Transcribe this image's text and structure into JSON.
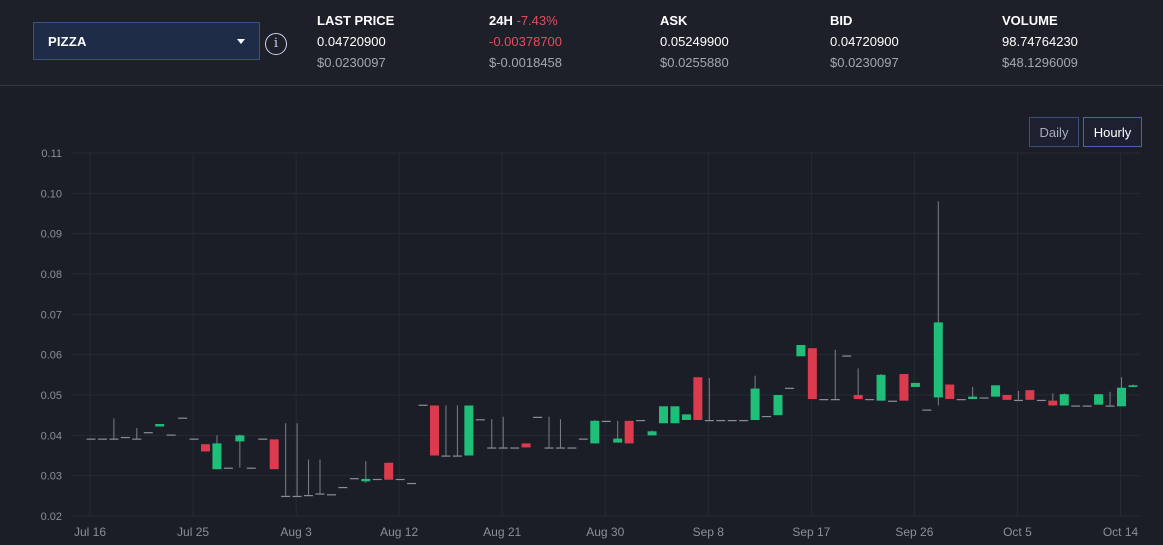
{
  "pair_selector": {
    "label": "PIZZA"
  },
  "stats": {
    "last_price": {
      "title": "LAST PRICE",
      "value": "0.04720900",
      "usd": "$0.0230097"
    },
    "change_24h": {
      "title": "24H",
      "percent": "-7.43%",
      "value": "-0.00378700",
      "usd": "$-0.0018458"
    },
    "ask": {
      "title": "ASK",
      "value": "0.05249900",
      "usd": "$0.0255880"
    },
    "bid": {
      "title": "BID",
      "value": "0.04720900",
      "usd": "$0.0230097"
    },
    "volume": {
      "title": "VOLUME",
      "value": "98.74764230",
      "usd": "$48.1296009"
    }
  },
  "timeframe": {
    "daily_label": "Daily",
    "hourly_label": "Hourly",
    "selected": "Hourly"
  },
  "colors": {
    "up": "#1fbf79",
    "down": "#dc3b4e",
    "wick": "#7b7f8a",
    "grid": "#262a34",
    "axis_text": "#8b8f99",
    "accent": "#34518a"
  },
  "chart_data": {
    "type": "candlestick",
    "x_tick_labels": [
      "Jul 16",
      "Jul 25",
      "Aug 3",
      "Aug 12",
      "Aug 21",
      "Aug 30",
      "Sep 8",
      "Sep 17",
      "Sep 26",
      "Oct 5",
      "Oct 14"
    ],
    "y_tick_labels": [
      "0.11",
      "0.10",
      "0.09",
      "0.08",
      "0.07",
      "0.06",
      "0.05",
      "0.04",
      "0.03",
      "0.02"
    ],
    "ylim": [
      0.02,
      0.11
    ],
    "x_start": "Jul 16",
    "grid": true,
    "candles": [
      {
        "date": "Jul 16",
        "o": 0.0392,
        "h": 0.0392,
        "l": 0.0392,
        "c": 0.0392
      },
      {
        "date": "Jul 17",
        "o": 0.0392,
        "h": 0.0392,
        "l": 0.0392,
        "c": 0.0392
      },
      {
        "date": "Jul 18",
        "o": 0.0392,
        "h": 0.0442,
        "l": 0.0392,
        "c": 0.0392
      },
      {
        "date": "Jul 19",
        "o": 0.0396,
        "h": 0.0396,
        "l": 0.0396,
        "c": 0.0396
      },
      {
        "date": "Jul 20",
        "o": 0.0392,
        "h": 0.0418,
        "l": 0.0392,
        "c": 0.0392
      },
      {
        "date": "Jul 21",
        "o": 0.0408,
        "h": 0.0408,
        "l": 0.0408,
        "c": 0.0408
      },
      {
        "date": "Jul 22",
        "o": 0.0422,
        "h": 0.0428,
        "l": 0.0422,
        "c": 0.0428
      },
      {
        "date": "Jul 23",
        "o": 0.0402,
        "h": 0.0402,
        "l": 0.0402,
        "c": 0.0402
      },
      {
        "date": "Jul 24",
        "o": 0.0444,
        "h": 0.0444,
        "l": 0.0444,
        "c": 0.0444
      },
      {
        "date": "Jul 25",
        "o": 0.0392,
        "h": 0.0392,
        "l": 0.0392,
        "c": 0.0392
      },
      {
        "date": "Jul 26",
        "o": 0.0378,
        "h": 0.0378,
        "l": 0.036,
        "c": 0.036
      },
      {
        "date": "Jul 27",
        "o": 0.0316,
        "h": 0.04,
        "l": 0.0316,
        "c": 0.038
      },
      {
        "date": "Jul 28",
        "o": 0.032,
        "h": 0.032,
        "l": 0.032,
        "c": 0.032
      },
      {
        "date": "Jul 29",
        "o": 0.0385,
        "h": 0.0402,
        "l": 0.032,
        "c": 0.04
      },
      {
        "date": "Jul 30",
        "o": 0.032,
        "h": 0.032,
        "l": 0.032,
        "c": 0.032
      },
      {
        "date": "Jul 31",
        "o": 0.0392,
        "h": 0.0392,
        "l": 0.0392,
        "c": 0.0392
      },
      {
        "date": "Aug 1",
        "o": 0.039,
        "h": 0.039,
        "l": 0.0316,
        "c": 0.0316
      },
      {
        "date": "Aug 2",
        "o": 0.025,
        "h": 0.043,
        "l": 0.025,
        "c": 0.025
      },
      {
        "date": "Aug 3",
        "o": 0.025,
        "h": 0.043,
        "l": 0.025,
        "c": 0.025
      },
      {
        "date": "Aug 4",
        "o": 0.0252,
        "h": 0.034,
        "l": 0.0252,
        "c": 0.0252
      },
      {
        "date": "Aug 5",
        "o": 0.0256,
        "h": 0.034,
        "l": 0.0256,
        "c": 0.0256
      },
      {
        "date": "Aug 6",
        "o": 0.0254,
        "h": 0.0254,
        "l": 0.0254,
        "c": 0.0254
      },
      {
        "date": "Aug 7",
        "o": 0.0272,
        "h": 0.0272,
        "l": 0.0272,
        "c": 0.0272
      },
      {
        "date": "Aug 8",
        "o": 0.0294,
        "h": 0.0294,
        "l": 0.0294,
        "c": 0.0294
      },
      {
        "date": "Aug 9",
        "o": 0.0286,
        "h": 0.0336,
        "l": 0.0282,
        "c": 0.0292
      },
      {
        "date": "Aug 10",
        "o": 0.0292,
        "h": 0.0292,
        "l": 0.0292,
        "c": 0.0292
      },
      {
        "date": "Aug 11",
        "o": 0.0332,
        "h": 0.0332,
        "l": 0.029,
        "c": 0.029
      },
      {
        "date": "Aug 12",
        "o": 0.0292,
        "h": 0.0292,
        "l": 0.0292,
        "c": 0.0292
      },
      {
        "date": "Aug 13",
        "o": 0.0282,
        "h": 0.0282,
        "l": 0.0282,
        "c": 0.0282
      },
      {
        "date": "Aug 14",
        "o": 0.0476,
        "h": 0.0476,
        "l": 0.0476,
        "c": 0.0476
      },
      {
        "date": "Aug 15",
        "o": 0.0474,
        "h": 0.0474,
        "l": 0.035,
        "c": 0.035
      },
      {
        "date": "Aug 16",
        "o": 0.035,
        "h": 0.0474,
        "l": 0.035,
        "c": 0.035
      },
      {
        "date": "Aug 17",
        "o": 0.035,
        "h": 0.0474,
        "l": 0.035,
        "c": 0.035
      },
      {
        "date": "Aug 18",
        "o": 0.035,
        "h": 0.0474,
        "l": 0.035,
        "c": 0.0474
      },
      {
        "date": "Aug 19",
        "o": 0.044,
        "h": 0.044,
        "l": 0.044,
        "c": 0.044
      },
      {
        "date": "Aug 20",
        "o": 0.037,
        "h": 0.044,
        "l": 0.037,
        "c": 0.037
      },
      {
        "date": "Aug 21",
        "o": 0.037,
        "h": 0.0446,
        "l": 0.037,
        "c": 0.037
      },
      {
        "date": "Aug 22",
        "o": 0.037,
        "h": 0.037,
        "l": 0.037,
        "c": 0.037
      },
      {
        "date": "Aug 23",
        "o": 0.038,
        "h": 0.038,
        "l": 0.037,
        "c": 0.037
      },
      {
        "date": "Aug 24",
        "o": 0.0446,
        "h": 0.0446,
        "l": 0.0446,
        "c": 0.0446
      },
      {
        "date": "Aug 25",
        "o": 0.037,
        "h": 0.0446,
        "l": 0.037,
        "c": 0.037
      },
      {
        "date": "Aug 26",
        "o": 0.037,
        "h": 0.044,
        "l": 0.037,
        "c": 0.037
      },
      {
        "date": "Aug 27",
        "o": 0.037,
        "h": 0.037,
        "l": 0.037,
        "c": 0.037
      },
      {
        "date": "Aug 28",
        "o": 0.0392,
        "h": 0.0392,
        "l": 0.0392,
        "c": 0.0392
      },
      {
        "date": "Aug 29",
        "o": 0.038,
        "h": 0.0438,
        "l": 0.038,
        "c": 0.0436
      },
      {
        "date": "Aug 30",
        "o": 0.0436,
        "h": 0.0436,
        "l": 0.0436,
        "c": 0.0436
      },
      {
        "date": "Aug 31",
        "o": 0.0382,
        "h": 0.0436,
        "l": 0.0382,
        "c": 0.0392
      },
      {
        "date": "Sep 1",
        "o": 0.0436,
        "h": 0.0436,
        "l": 0.038,
        "c": 0.038
      },
      {
        "date": "Sep 2",
        "o": 0.0438,
        "h": 0.0438,
        "l": 0.0438,
        "c": 0.0438
      },
      {
        "date": "Sep 3",
        "o": 0.04,
        "h": 0.0412,
        "l": 0.04,
        "c": 0.041
      },
      {
        "date": "Sep 4",
        "o": 0.043,
        "h": 0.0472,
        "l": 0.043,
        "c": 0.0472
      },
      {
        "date": "Sep 5",
        "o": 0.043,
        "h": 0.0472,
        "l": 0.043,
        "c": 0.0472
      },
      {
        "date": "Sep 6",
        "o": 0.0438,
        "h": 0.0452,
        "l": 0.0438,
        "c": 0.0452
      },
      {
        "date": "Sep 7",
        "o": 0.0544,
        "h": 0.0544,
        "l": 0.0438,
        "c": 0.0438
      },
      {
        "date": "Sep 8",
        "o": 0.0438,
        "h": 0.0542,
        "l": 0.0438,
        "c": 0.0438
      },
      {
        "date": "Sep 9",
        "o": 0.0438,
        "h": 0.0438,
        "l": 0.0438,
        "c": 0.0438
      },
      {
        "date": "Sep 10",
        "o": 0.0438,
        "h": 0.0438,
        "l": 0.0438,
        "c": 0.0438
      },
      {
        "date": "Sep 11",
        "o": 0.0438,
        "h": 0.0438,
        "l": 0.0438,
        "c": 0.0438
      },
      {
        "date": "Sep 12",
        "o": 0.0438,
        "h": 0.0548,
        "l": 0.0438,
        "c": 0.0516
      },
      {
        "date": "Sep 13",
        "o": 0.0448,
        "h": 0.0448,
        "l": 0.0448,
        "c": 0.0448
      },
      {
        "date": "Sep 14",
        "o": 0.045,
        "h": 0.05,
        "l": 0.045,
        "c": 0.05
      },
      {
        "date": "Sep 15",
        "o": 0.0518,
        "h": 0.0518,
        "l": 0.0518,
        "c": 0.0518
      },
      {
        "date": "Sep 16",
        "o": 0.0596,
        "h": 0.0624,
        "l": 0.0596,
        "c": 0.0624
      },
      {
        "date": "Sep 17",
        "o": 0.0616,
        "h": 0.0616,
        "l": 0.049,
        "c": 0.049
      },
      {
        "date": "Sep 18",
        "o": 0.049,
        "h": 0.049,
        "l": 0.049,
        "c": 0.049
      },
      {
        "date": "Sep 19",
        "o": 0.049,
        "h": 0.0612,
        "l": 0.049,
        "c": 0.049
      },
      {
        "date": "Sep 20",
        "o": 0.0598,
        "h": 0.0598,
        "l": 0.0598,
        "c": 0.0598
      },
      {
        "date": "Sep 21",
        "o": 0.05,
        "h": 0.0566,
        "l": 0.049,
        "c": 0.049
      },
      {
        "date": "Sep 22",
        "o": 0.049,
        "h": 0.049,
        "l": 0.049,
        "c": 0.049
      },
      {
        "date": "Sep 23",
        "o": 0.0486,
        "h": 0.0552,
        "l": 0.0486,
        "c": 0.055
      },
      {
        "date": "Sep 24",
        "o": 0.0486,
        "h": 0.0486,
        "l": 0.0486,
        "c": 0.0486
      },
      {
        "date": "Sep 25",
        "o": 0.0552,
        "h": 0.0552,
        "l": 0.0486,
        "c": 0.0486
      },
      {
        "date": "Sep 26",
        "o": 0.052,
        "h": 0.053,
        "l": 0.052,
        "c": 0.053
      },
      {
        "date": "Sep 27",
        "o": 0.0464,
        "h": 0.0464,
        "l": 0.0464,
        "c": 0.0464
      },
      {
        "date": "Sep 28",
        "o": 0.0494,
        "h": 0.098,
        "l": 0.0474,
        "c": 0.068
      },
      {
        "date": "Sep 29",
        "o": 0.0526,
        "h": 0.0526,
        "l": 0.049,
        "c": 0.049
      },
      {
        "date": "Sep 30",
        "o": 0.049,
        "h": 0.049,
        "l": 0.049,
        "c": 0.049
      },
      {
        "date": "Oct 1",
        "o": 0.049,
        "h": 0.052,
        "l": 0.049,
        "c": 0.0496
      },
      {
        "date": "Oct 2",
        "o": 0.0494,
        "h": 0.0494,
        "l": 0.0494,
        "c": 0.0494
      },
      {
        "date": "Oct 3",
        "o": 0.0496,
        "h": 0.0524,
        "l": 0.0496,
        "c": 0.0524
      },
      {
        "date": "Oct 4",
        "o": 0.05,
        "h": 0.05,
        "l": 0.0488,
        "c": 0.0488
      },
      {
        "date": "Oct 5",
        "o": 0.0488,
        "h": 0.051,
        "l": 0.0488,
        "c": 0.0488
      },
      {
        "date": "Oct 6",
        "o": 0.0512,
        "h": 0.0512,
        "l": 0.0488,
        "c": 0.0488
      },
      {
        "date": "Oct 7",
        "o": 0.0488,
        "h": 0.0488,
        "l": 0.0488,
        "c": 0.0488
      },
      {
        "date": "Oct 8",
        "o": 0.0486,
        "h": 0.0504,
        "l": 0.0474,
        "c": 0.0474
      },
      {
        "date": "Oct 9",
        "o": 0.0474,
        "h": 0.0504,
        "l": 0.0474,
        "c": 0.0502
      },
      {
        "date": "Oct 10",
        "o": 0.0474,
        "h": 0.0474,
        "l": 0.0474,
        "c": 0.0474
      },
      {
        "date": "Oct 11",
        "o": 0.0474,
        "h": 0.0474,
        "l": 0.0474,
        "c": 0.0474
      },
      {
        "date": "Oct 12",
        "o": 0.0476,
        "h": 0.0502,
        "l": 0.0476,
        "c": 0.0502
      },
      {
        "date": "Oct 13",
        "o": 0.0474,
        "h": 0.0508,
        "l": 0.0474,
        "c": 0.0474
      },
      {
        "date": "Oct 14",
        "o": 0.0472,
        "h": 0.0544,
        "l": 0.0472,
        "c": 0.0518
      },
      {
        "date": "Oct 15",
        "o": 0.052,
        "h": 0.0526,
        "l": 0.052,
        "c": 0.0524
      }
    ]
  }
}
